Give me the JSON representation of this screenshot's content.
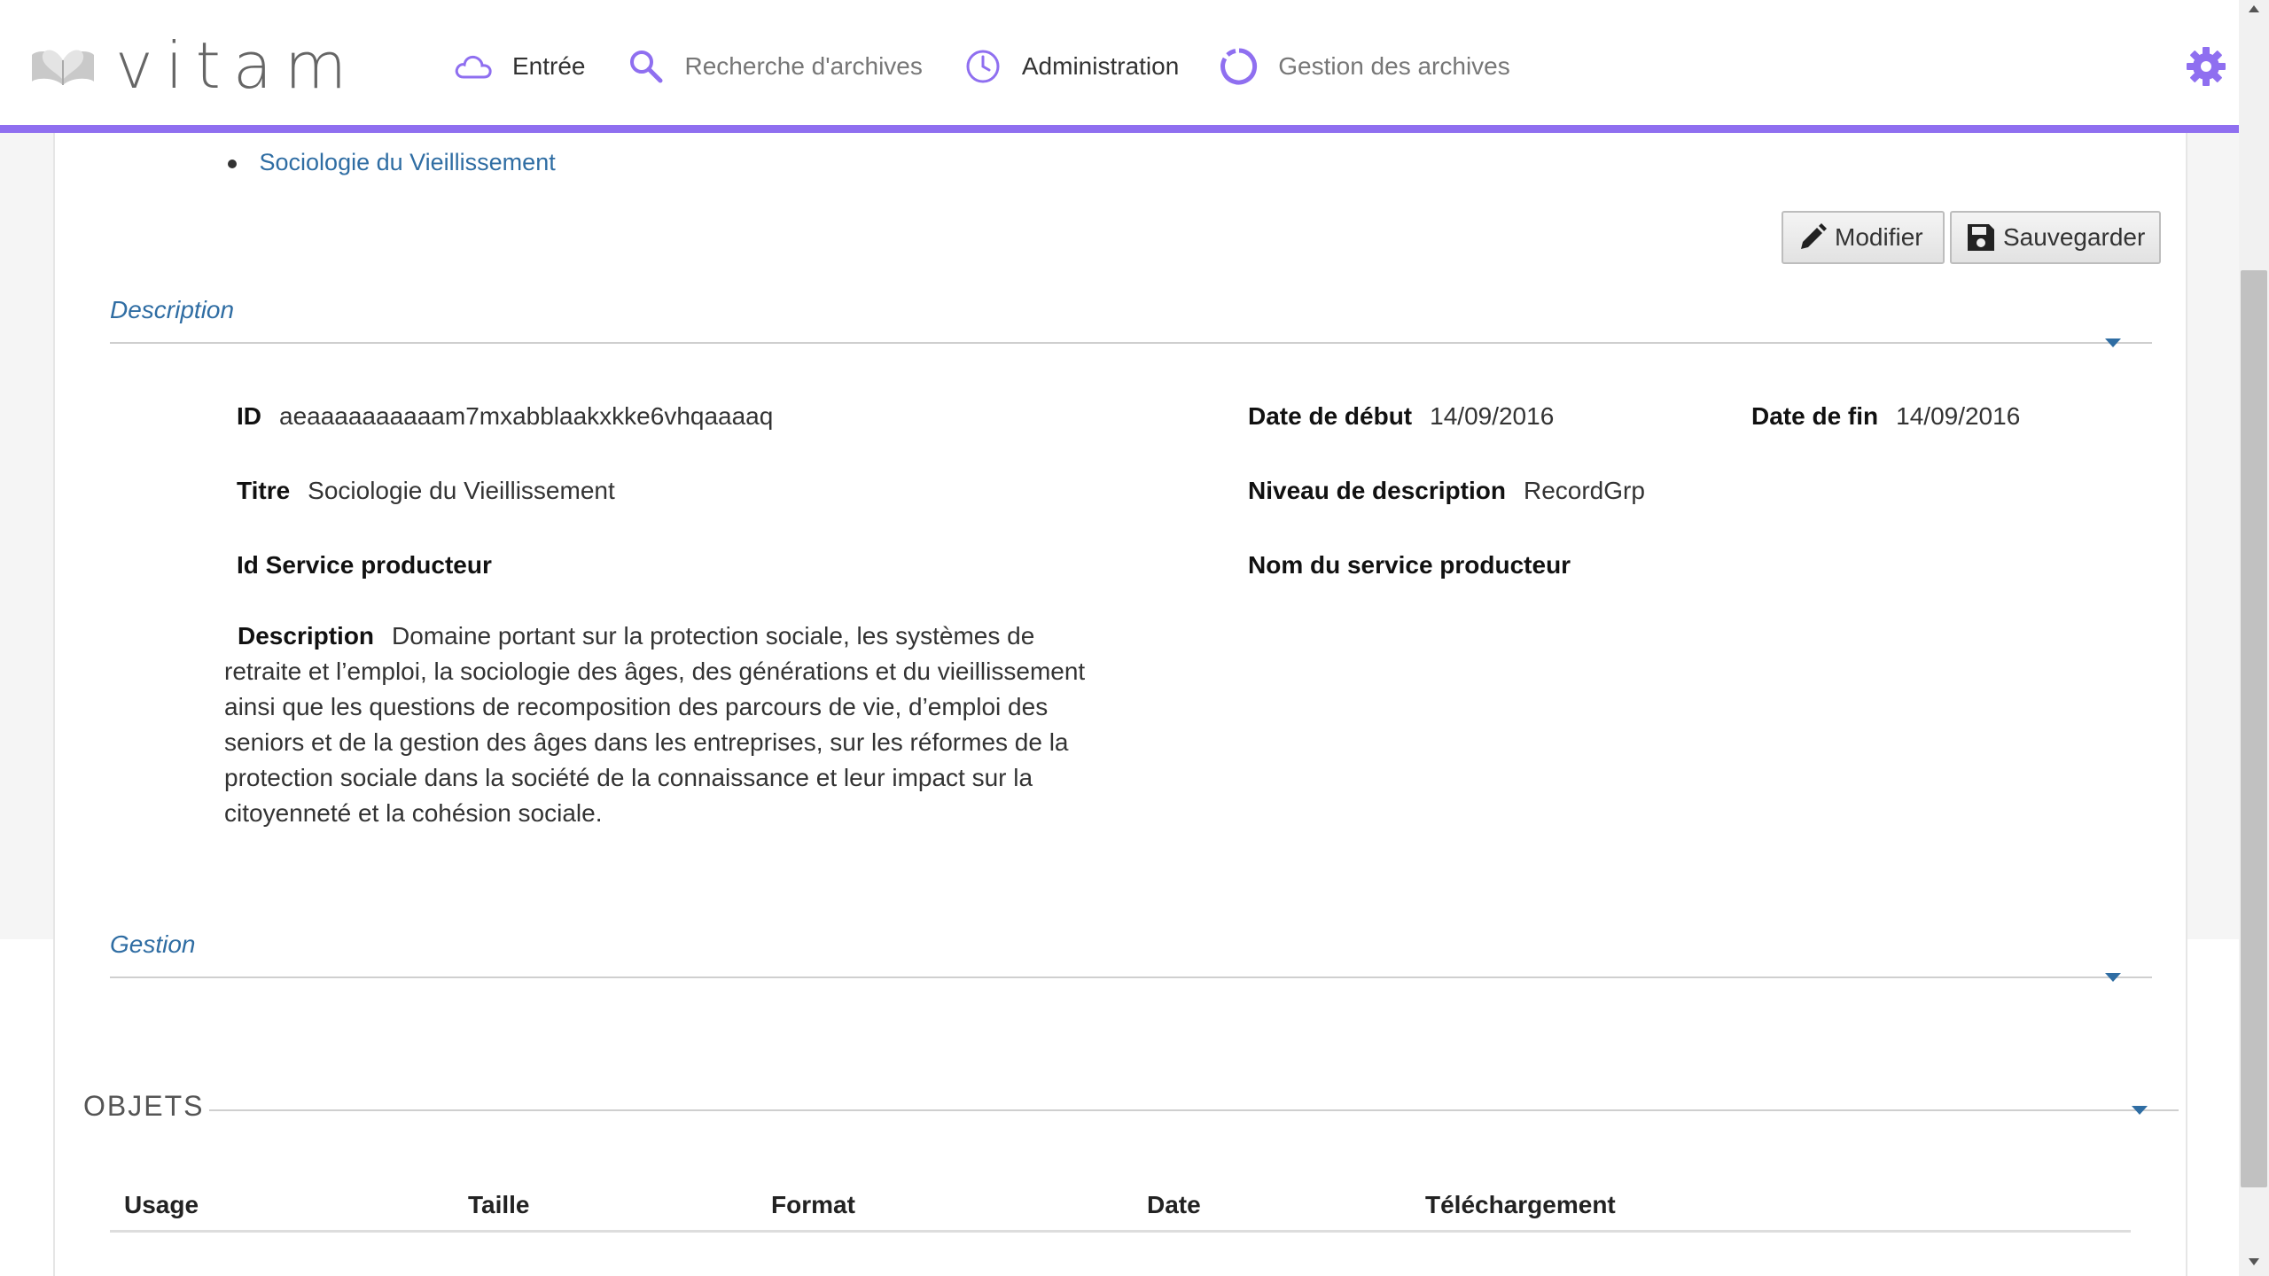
{
  "header": {
    "logo_text": "vitam",
    "nav": [
      {
        "label": "Entrée",
        "icon": "cloud-icon"
      },
      {
        "label": "Recherche d'archives",
        "icon": "search-icon"
      },
      {
        "label": "Administration",
        "icon": "clock-icon"
      },
      {
        "label": "Gestion des archives",
        "icon": "circle-progress-icon"
      }
    ],
    "settings_icon": "gear-icon",
    "accent_color": "#8f6ff0"
  },
  "breadcrumb": {
    "item": "Sociologie du Vieillissement"
  },
  "toolbar": {
    "modify_label": "Modifier",
    "save_label": "Sauvegarder"
  },
  "description_section": {
    "title": "Description",
    "fields": {
      "id": {
        "label": "ID",
        "value": "aeaaaaaaaaaam7mxabblaakxkke6vhqaaaaq"
      },
      "start_date": {
        "label": "Date de début",
        "value": "14/09/2016"
      },
      "end_date": {
        "label": "Date de fin",
        "value": "14/09/2016"
      },
      "title": {
        "label": "Titre",
        "value": "Sociologie du Vieillissement"
      },
      "level": {
        "label": "Niveau de description",
        "value": "RecordGrp"
      },
      "producer_id": {
        "label": "Id Service producteur",
        "value": ""
      },
      "producer_name": {
        "label": "Nom du service producteur",
        "value": ""
      },
      "description": {
        "label": "Description",
        "value": "Domaine portant sur la protection sociale, les systèmes de retraite et l’emploi, la sociologie des âges, des générations et du vieillissement ainsi que les questions de recomposition des parcours de vie, d’emploi des seniors et de la gestion des âges dans les entreprises, sur les réformes de la protection sociale dans la société de la connaissance et leur impact sur la citoyenneté et la cohésion sociale."
      }
    }
  },
  "management_section": {
    "title": "Gestion"
  },
  "objects_section": {
    "title": "OBJETS",
    "columns": [
      "Usage",
      "Taille",
      "Format",
      "Date",
      "Téléchargement"
    ]
  },
  "link_color": "#2f6da3"
}
